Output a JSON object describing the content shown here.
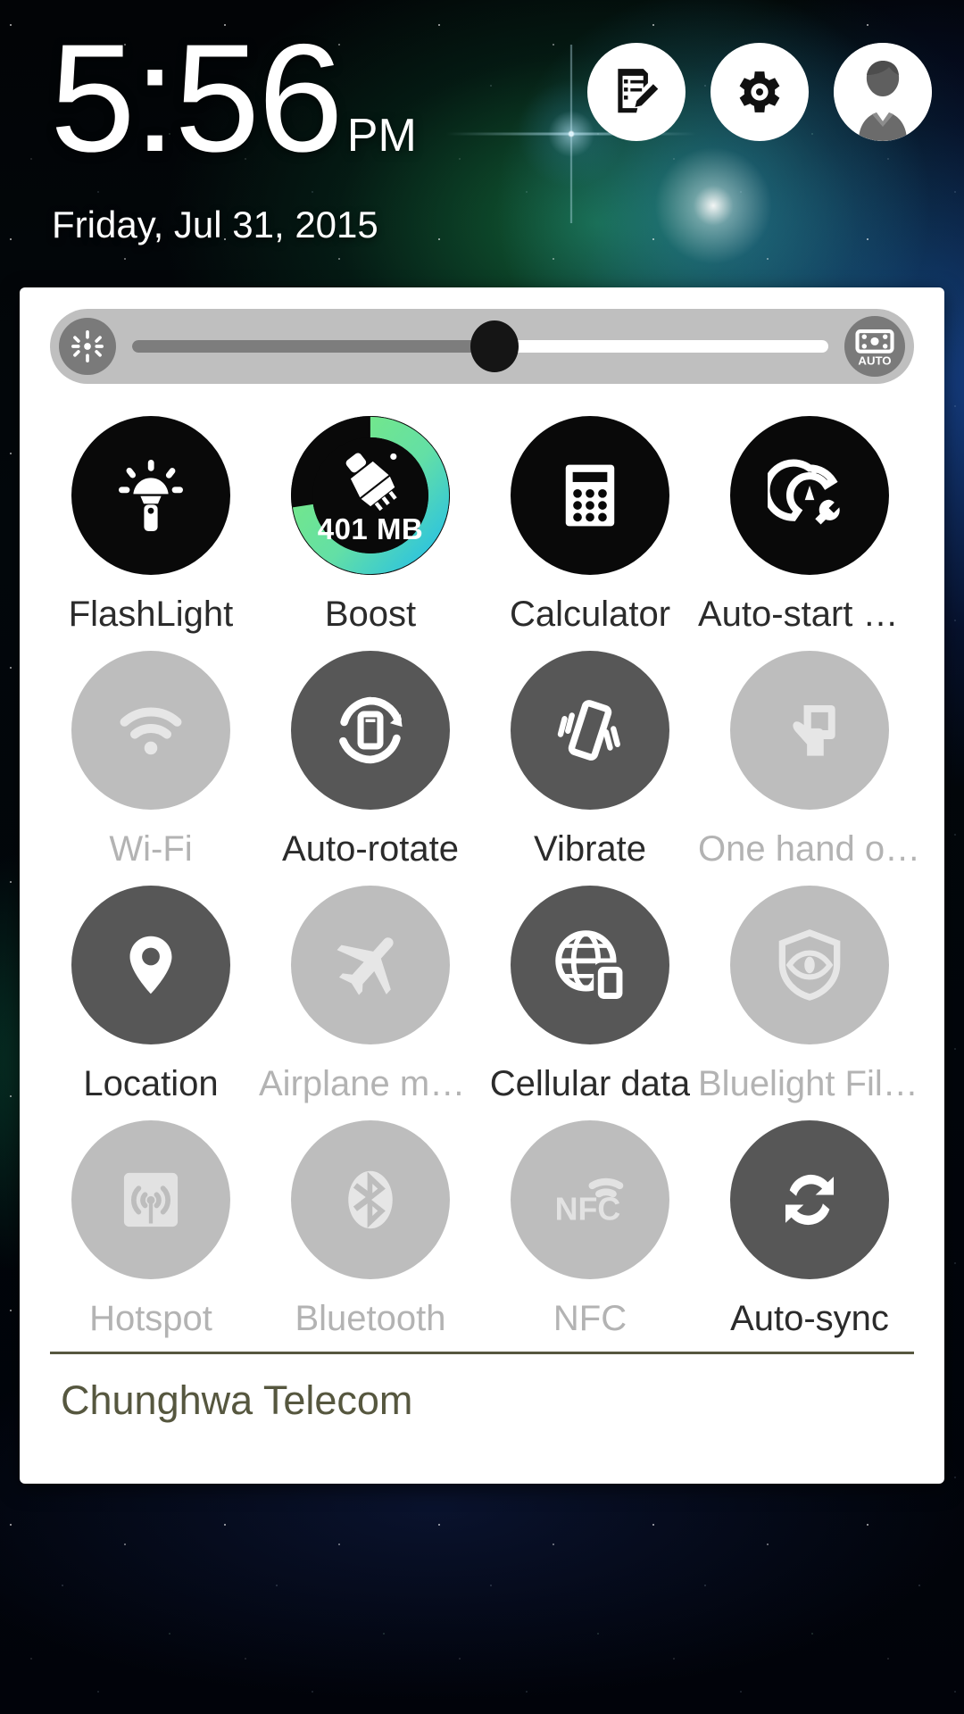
{
  "status": {
    "time": "5:56",
    "ampm": "PM",
    "date": "Friday, Jul 31, 2015"
  },
  "header_buttons": [
    {
      "name": "notes-edit-icon",
      "label": "Notes"
    },
    {
      "name": "gear-icon",
      "label": "Settings"
    },
    {
      "name": "user-avatar-icon",
      "label": "User"
    }
  ],
  "brightness": {
    "left_icon": "brightness-icon",
    "right_icon": "auto-brightness-icon",
    "auto_label": "AUTO",
    "value_percent": 52
  },
  "tiles": [
    {
      "label": "FlashLight",
      "icon": "flashlight-icon",
      "state": "black"
    },
    {
      "label": "Boost",
      "icon": "boost-broom-icon",
      "state": "black",
      "badge": "401 MB",
      "ring_green_pct": 46,
      "ring_cyan_pct": 26
    },
    {
      "label": "Calculator",
      "icon": "calculator-icon",
      "state": "black"
    },
    {
      "label": "Auto-start M…",
      "icon": "autostart-icon",
      "state": "black"
    },
    {
      "label": "Wi-Fi",
      "icon": "wifi-icon",
      "state": "off"
    },
    {
      "label": "Auto-rotate",
      "icon": "auto-rotate-icon",
      "state": "on"
    },
    {
      "label": "Vibrate",
      "icon": "vibrate-icon",
      "state": "on"
    },
    {
      "label": "One hand op…",
      "icon": "one-hand-icon",
      "state": "off"
    },
    {
      "label": "Location",
      "icon": "location-pin-icon",
      "state": "on"
    },
    {
      "label": "Airplane mo…",
      "icon": "airplane-icon",
      "state": "off"
    },
    {
      "label": "Cellular data",
      "icon": "cellular-data-icon",
      "state": "on"
    },
    {
      "label": "Bluelight Filter",
      "icon": "bluelight-shield-icon",
      "state": "off"
    },
    {
      "label": "Hotspot",
      "icon": "hotspot-icon",
      "state": "off"
    },
    {
      "label": "Bluetooth",
      "icon": "bluetooth-icon",
      "state": "off"
    },
    {
      "label": "NFC",
      "icon": "nfc-icon",
      "state": "off"
    },
    {
      "label": "Auto-sync",
      "icon": "auto-sync-icon",
      "state": "on"
    }
  ],
  "carrier": "Chunghwa Telecom",
  "colors": {
    "tile_black": "#090909",
    "tile_on": "#575757",
    "tile_off": "#bdbdbd",
    "label_on": "#2b2b2b",
    "label_off": "#b3b3b3",
    "carrier_text": "#56573f",
    "boost_ring_green": "#7ceb7c",
    "boost_ring_cyan": "#2cc3e0",
    "panel_bg": "#ffffff",
    "slider_bg": "#bfbfbf"
  }
}
